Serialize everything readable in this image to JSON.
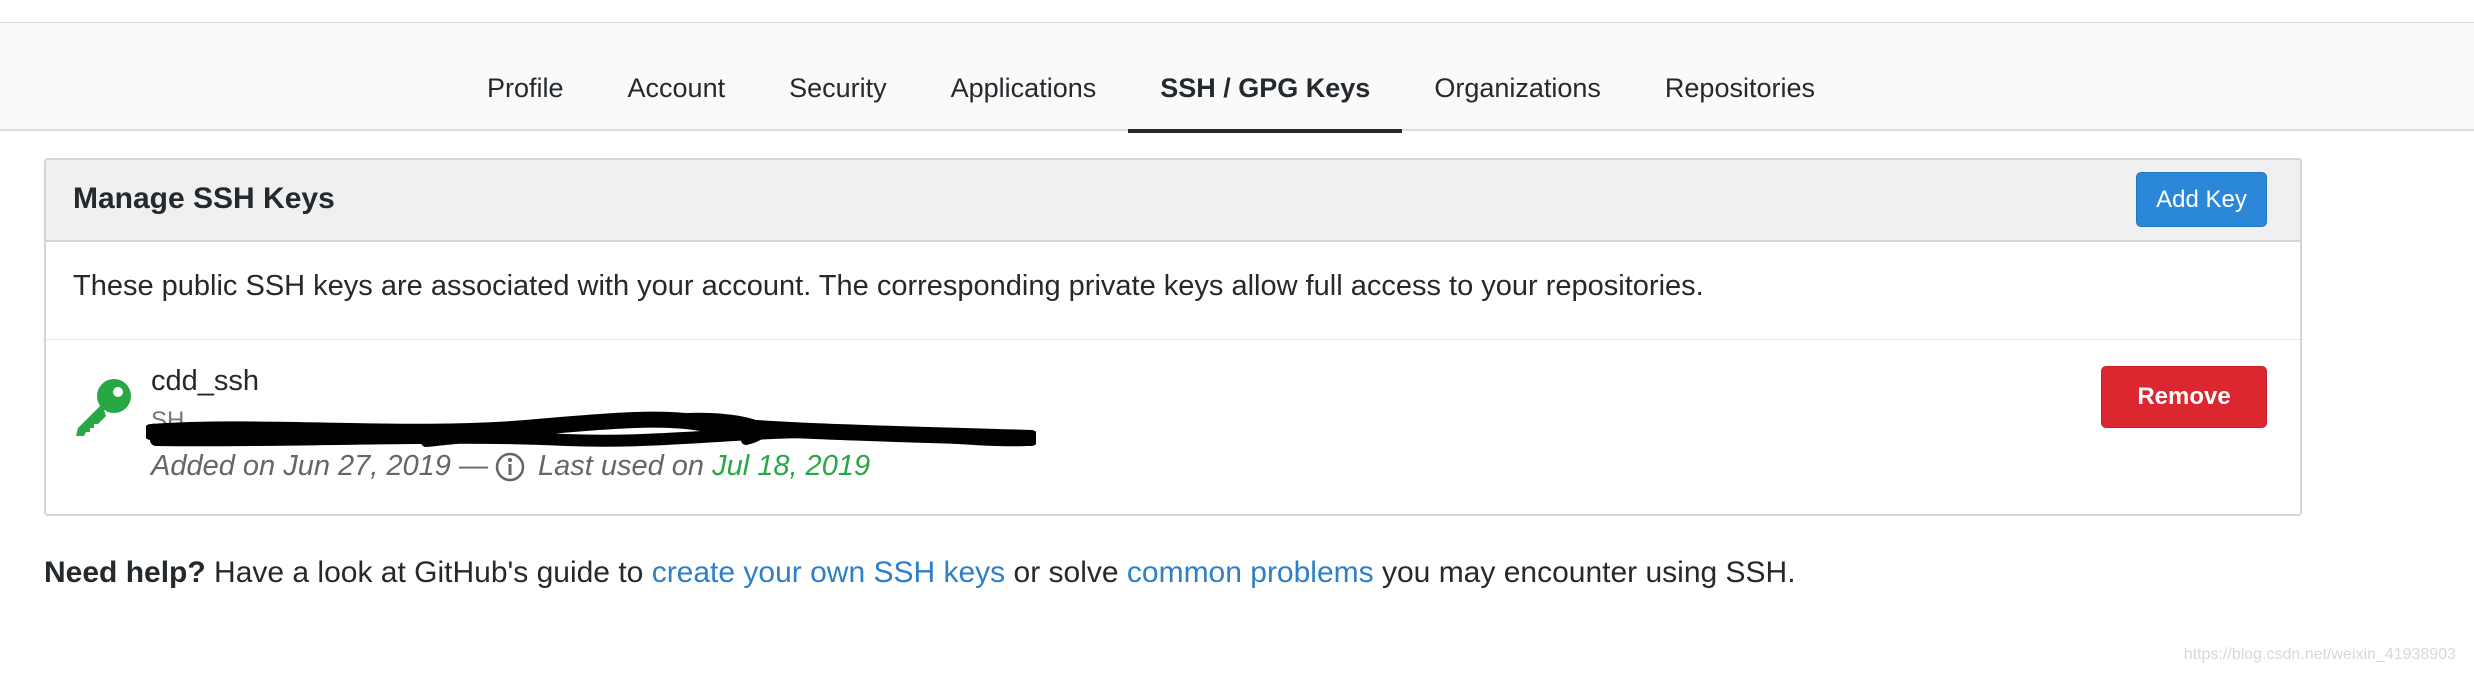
{
  "nav": {
    "tabs": [
      {
        "label": "Profile"
      },
      {
        "label": "Account"
      },
      {
        "label": "Security"
      },
      {
        "label": "Applications"
      },
      {
        "label": "SSH / GPG Keys",
        "active": true
      },
      {
        "label": "Organizations"
      },
      {
        "label": "Repositories"
      }
    ]
  },
  "panel": {
    "title": "Manage SSH Keys",
    "add_key_label": "Add Key",
    "description": "These public SSH keys are associated with your account. The corresponding private keys allow full access to your repositories.",
    "keys": [
      {
        "name": "cdd_ssh",
        "fingerprint_fragment": "SH",
        "added": "Added on Jun 27, 2019 —",
        "last_used_prefix": "Last used on",
        "last_used_date": "Jul 18, 2019",
        "remove_label": "Remove",
        "icon": "key-icon",
        "icon_color": "#28a745"
      }
    ]
  },
  "help": {
    "lead": "Need help?",
    "text1": " Have a look at GitHub's guide to ",
    "link1": "create your own SSH keys",
    "text2": " or solve ",
    "link2": "common problems",
    "text3": " you may encounter using SSH."
  },
  "watermark": "https://blog.csdn.net/weixin_41938903",
  "colors": {
    "primary_button": "#2b87d7",
    "danger_button": "#dc2630",
    "link": "#2d7fc6",
    "success": "#28a745"
  }
}
